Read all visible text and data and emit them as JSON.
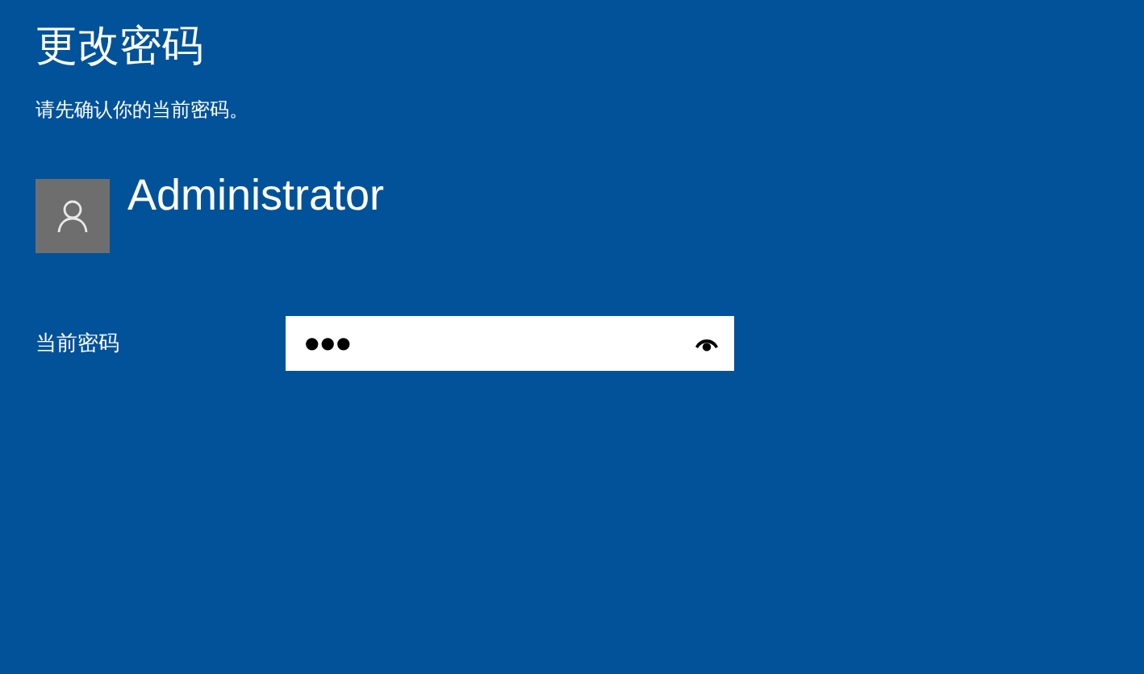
{
  "title": "更改密码",
  "subtitle": "请先确认你的当前密码。",
  "user": {
    "name": "Administrator"
  },
  "password_field": {
    "label": "当前密码",
    "value": "●●●"
  }
}
